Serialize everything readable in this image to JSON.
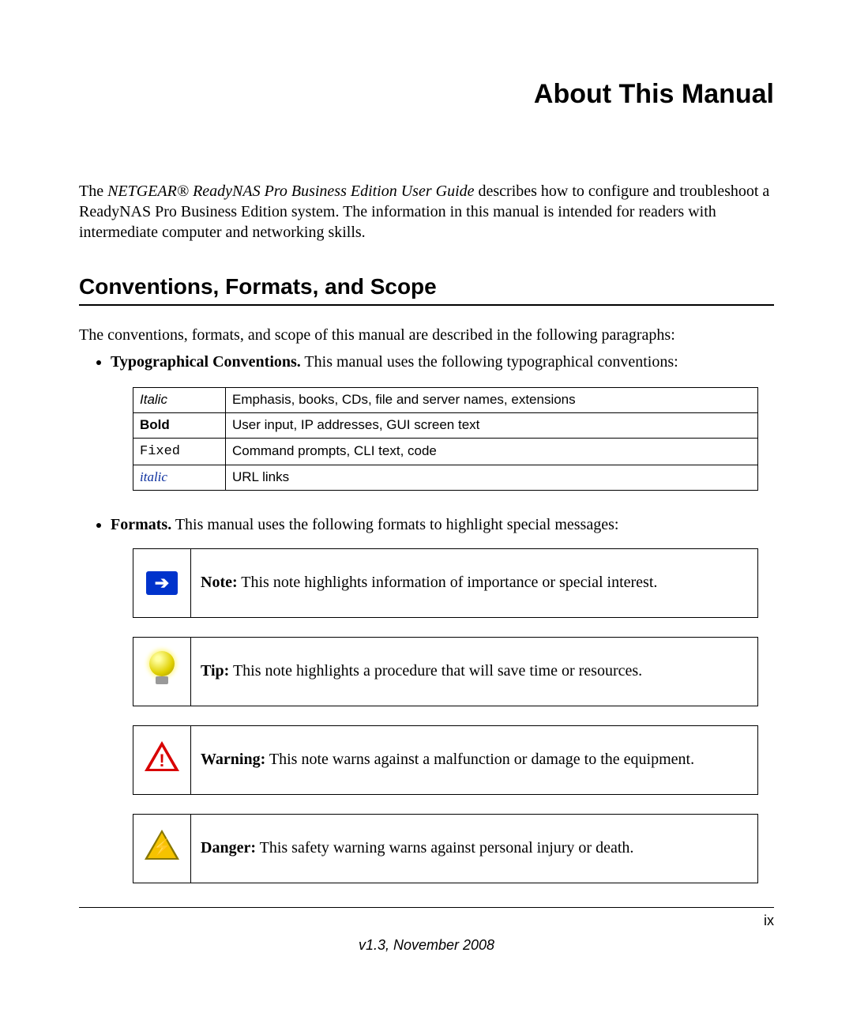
{
  "title": "About This Manual",
  "intro": {
    "pre": "The ",
    "em": "NETGEAR® ReadyNAS Pro Business Edition User Guide",
    "post": " describes how to configure and troubleshoot a ReadyNAS Pro Business Edition system. The information in this manual is intended for readers with intermediate computer and networking skills."
  },
  "section_heading": "Conventions, Formats, and Scope",
  "conventions_intro": "The conventions, formats, and scope of this manual are described in the following paragraphs:",
  "typographical": {
    "label": "Typographical Conventions.",
    "text": " This manual uses the following typographical conventions:"
  },
  "conv_table": [
    {
      "label": "Italic",
      "labelClass": "italic-ss",
      "desc": "Emphasis, books, CDs, file and server names, extensions"
    },
    {
      "label": "Bold",
      "labelClass": "bold-ss",
      "desc": "User input, IP addresses, GUI screen text"
    },
    {
      "label": "Fixed",
      "labelClass": "fixed-ss",
      "desc": "Command prompts, CLI text, code"
    },
    {
      "label": "italic",
      "labelClass": "link-italic",
      "desc": "URL links"
    }
  ],
  "formats": {
    "label": "Formats.",
    "text": " This manual uses the following formats to highlight special messages:"
  },
  "callouts": {
    "note": {
      "label": "Note:",
      "text": " This note highlights information of importance or special interest."
    },
    "tip": {
      "label": "Tip:",
      "text": " This note highlights a procedure that will save time or resources."
    },
    "warning": {
      "label": "Warning:",
      "text": " This note warns against a malfunction or damage to the equipment."
    },
    "danger": {
      "label": "Danger:",
      "text": " This safety warning warns against personal injury or death."
    }
  },
  "page_number": "ix",
  "version": "v1.3, November 2008"
}
